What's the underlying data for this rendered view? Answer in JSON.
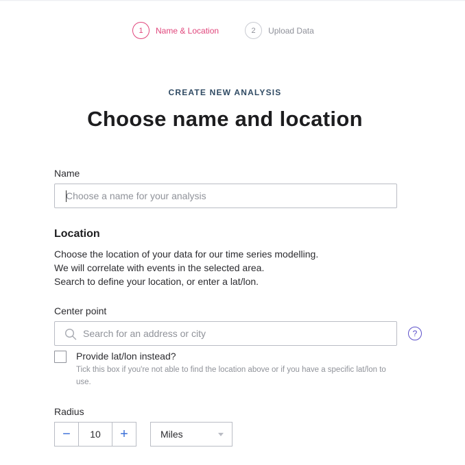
{
  "stepper": {
    "steps": [
      {
        "number": "1",
        "label": "Name & Location",
        "active": true
      },
      {
        "number": "2",
        "label": "Upload Data",
        "active": false
      }
    ]
  },
  "header": {
    "eyebrow": "CREATE NEW ANALYSIS",
    "title": "Choose name and location"
  },
  "name_field": {
    "label": "Name",
    "placeholder": "Choose a name for your analysis",
    "value": ""
  },
  "location": {
    "title": "Location",
    "description": [
      "Choose the location of your data for our time series modelling.",
      "We will correlate with events in the selected area.",
      "Search to define your location, or enter a lat/lon."
    ]
  },
  "center_point": {
    "label": "Center point",
    "placeholder": "Search for an address or city",
    "value": "",
    "help_icon": "?"
  },
  "latlon_checkbox": {
    "label": "Provide lat/lon instead?",
    "checked": false,
    "hint": "Tick this box if you're not able to find the location above or if you have a specific lat/lon to use."
  },
  "radius": {
    "label": "Radius",
    "value": "10",
    "decrement": "−",
    "increment": "+",
    "unit": "Miles"
  },
  "colors": {
    "accent": "#e0457b",
    "link": "#3a6fd8",
    "help": "#5b4fc9"
  }
}
